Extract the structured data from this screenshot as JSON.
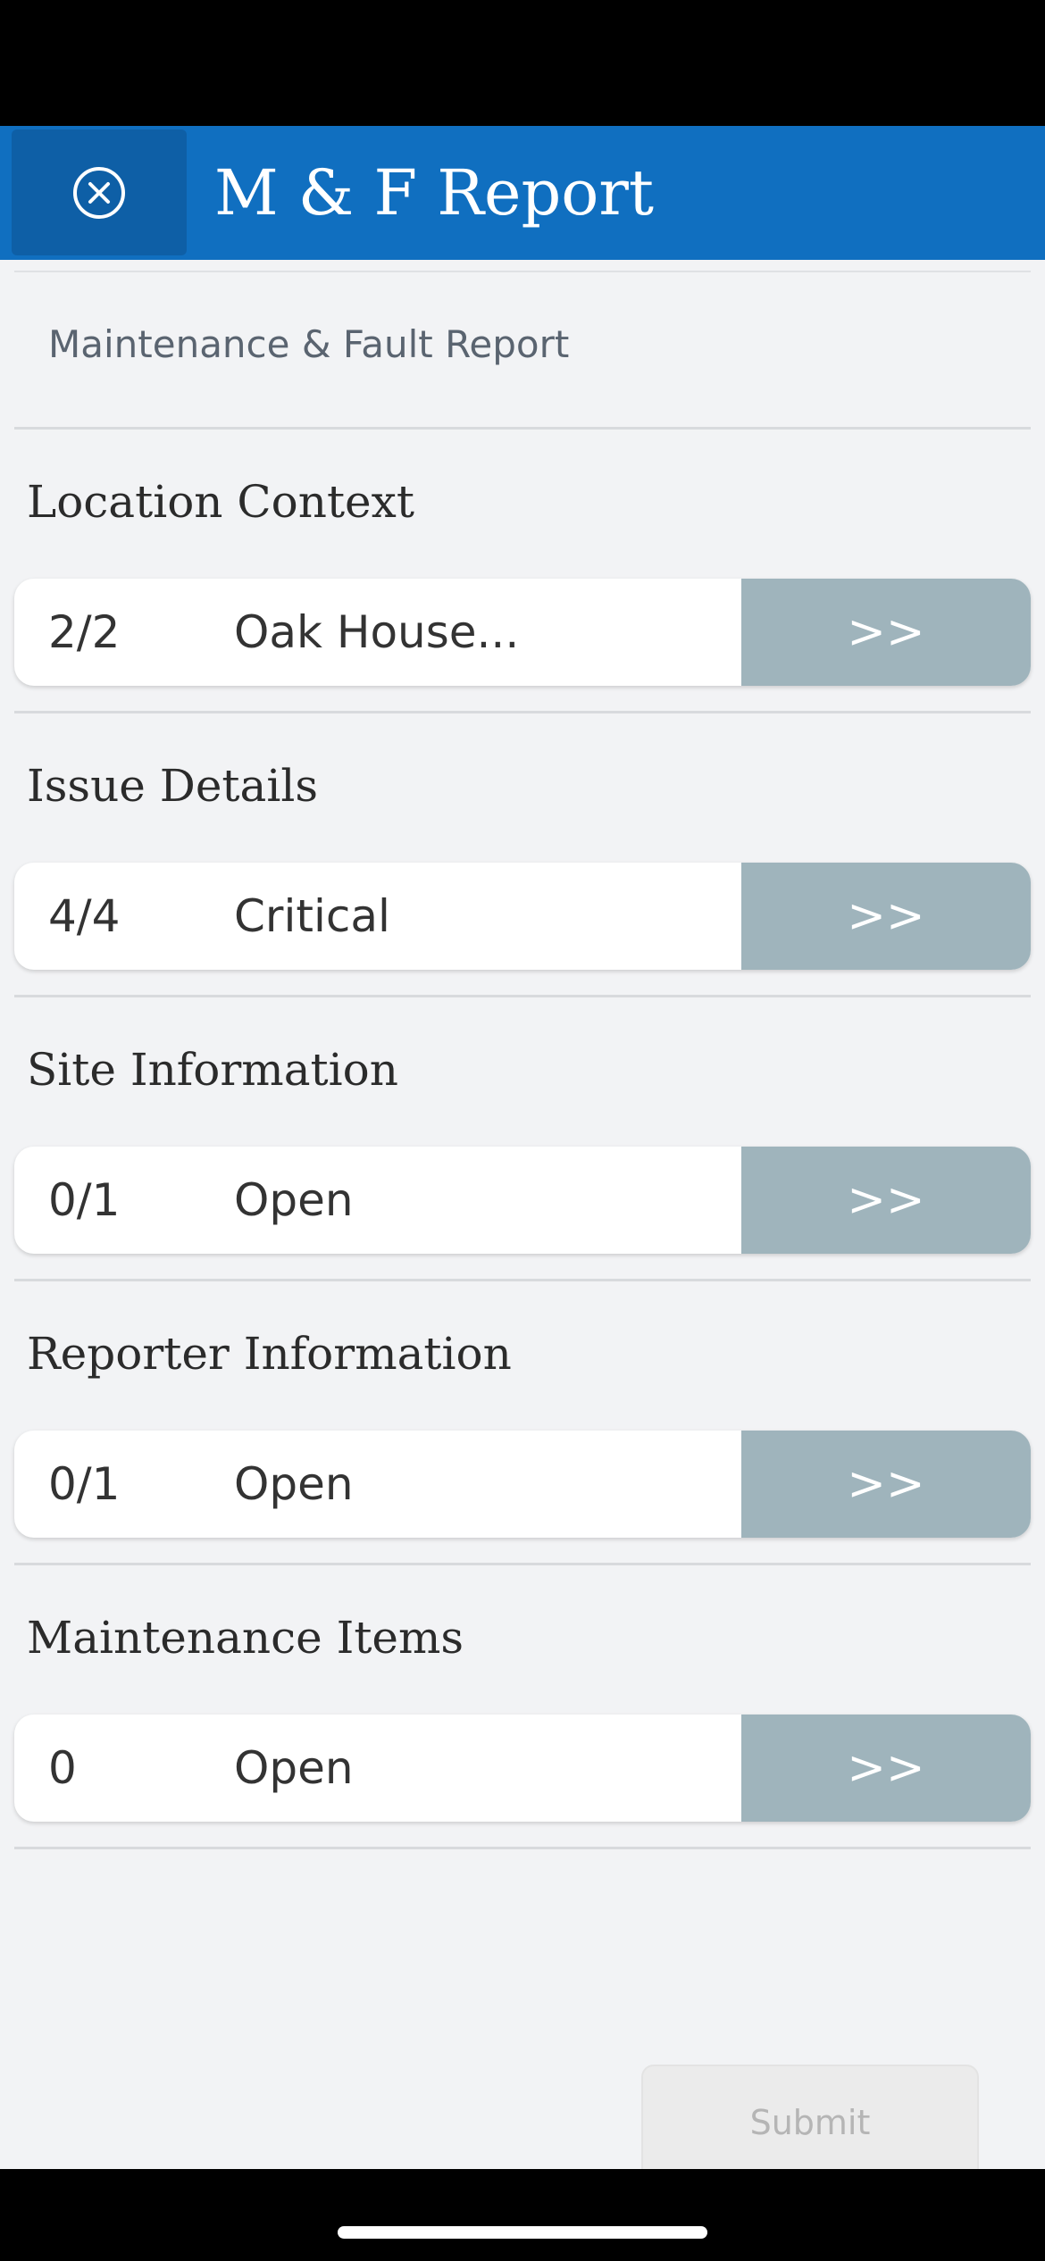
{
  "header": {
    "title": "M & F Report",
    "close_icon": "close-circle-icon"
  },
  "subtitle": "Maintenance & Fault Report",
  "sections": [
    {
      "title": "Location Context",
      "count": "2/2",
      "status": "Oak House...",
      "action": ">>"
    },
    {
      "title": "Issue Details",
      "count": "4/4",
      "status": "Critical",
      "action": ">>"
    },
    {
      "title": "Site Information",
      "count": "0/1",
      "status": "Open",
      "action": ">>"
    },
    {
      "title": "Reporter Information",
      "count": "0/1",
      "status": "Open",
      "action": ">>"
    },
    {
      "title": "Maintenance Items",
      "count": "0",
      "status": "Open",
      "action": ">>"
    }
  ],
  "submit_label": "Submit",
  "colors": {
    "header_bg": "#106fc0",
    "close_button_bg": "#0e5fa6",
    "arrow_button_bg": "#9fb4bc",
    "page_bg": "#f2f3f5"
  }
}
